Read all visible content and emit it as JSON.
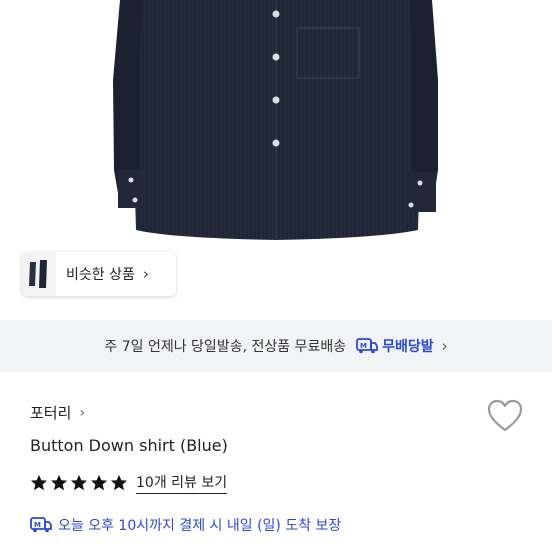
{
  "similar": {
    "label": "비슷한 상품",
    "chevron": "›"
  },
  "delivery": {
    "text": "주 7일 언제나 당일발송, 전상품 무료배송",
    "badge_label": "무배당발",
    "badge_icon": "truck-m-icon",
    "chevron": "›",
    "accent": "#2c49d6"
  },
  "product": {
    "brand": "포터리",
    "brand_chevron": "›",
    "title": "Button Down shirt (Blue)",
    "rating": 5,
    "reviews_link": "10개 리뷰 보기",
    "guarantee_text": "오늘 오후 10시까지 결제 시 내일 (일) 도착 보장"
  }
}
